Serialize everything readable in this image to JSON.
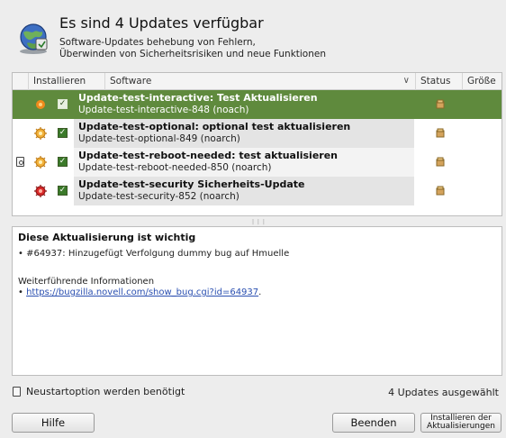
{
  "header": {
    "title": "Es sind 4 Updates verfügbar",
    "subtitle_line1": "Software-Updates behebung von Fehlern,",
    "subtitle_line2": "Überwinden von Sicherheitsrisiken und neue Funktionen"
  },
  "columns": {
    "installieren": "Installieren",
    "software": "Software",
    "status": "Status",
    "groesse": "Größe",
    "sort_indicator": "∨"
  },
  "updates": [
    {
      "name": "Update-test-interactive: Test Aktualisieren",
      "package": "Update-test-interactive-848 (noach)",
      "checked": true,
      "selected": true,
      "restart": false,
      "severity": "low"
    },
    {
      "name": "Update-test-optional: optional test aktualisieren",
      "package": "Update-test-optional-849 (noarch)",
      "checked": true,
      "selected": false,
      "restart": false,
      "severity": "optional"
    },
    {
      "name": "Update-test-reboot-needed: test aktualisieren",
      "package": "Update-test-reboot-needed-850 (noarch)",
      "checked": true,
      "selected": false,
      "restart": true,
      "severity": "normal"
    },
    {
      "name": "Update-test-security Sicherheits-Update",
      "package": "Update-test-security-852 (noarch)",
      "checked": true,
      "selected": false,
      "restart": false,
      "severity": "security"
    }
  ],
  "details": {
    "title": "Diese Aktualisierung ist wichtig",
    "bug_line": "• #64937: Hinzugefügt Verfolgung dummy bug auf Hmuelle",
    "more_info": "Weiterführende Informationen",
    "link_bullet": "• ",
    "link": "https://bugzilla.novell.com/show_bug.cgi?id=64937",
    "link_suffix": "."
  },
  "footer": {
    "restart_note": "Neustartoption werden benötigt",
    "count": "4 Updates ausgewählt"
  },
  "buttons": {
    "help": "Hilfe",
    "close": "Beenden",
    "install_line1": "Installieren der",
    "install_line2": "Aktualisierungen"
  },
  "colors": {
    "selected_row": "#5f8a3d",
    "checkbox": "#3b7a2a",
    "link": "#2a4fb0",
    "low_severity": "#f08a1c",
    "security_severity": "#d92a2a"
  }
}
